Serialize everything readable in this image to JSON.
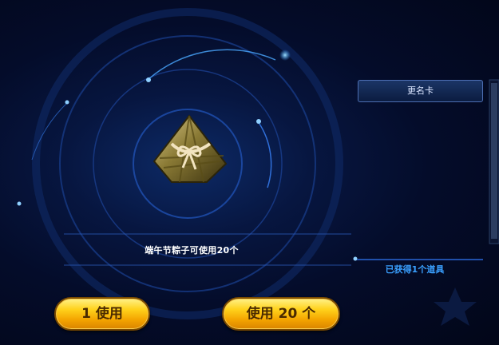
{
  "rename_card": {
    "label": "更名卡"
  },
  "item": {
    "icon": "zongzi-icon",
    "name_message": "端午节粽子可使用20个"
  },
  "obtained": {
    "text": "已获得1个道具"
  },
  "buttons": {
    "use_one": "1 使用",
    "use_twenty": "使用 20 个"
  },
  "colors": {
    "button_gold": "#ffd21c",
    "accent_blue": "#3aa0ff",
    "background": "#02061a"
  }
}
